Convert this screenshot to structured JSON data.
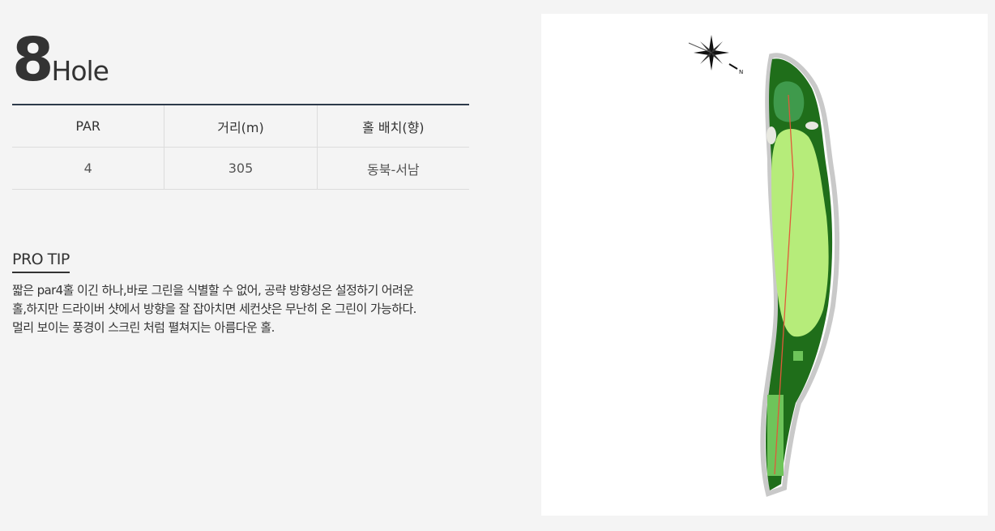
{
  "hole": {
    "number": "8",
    "label": "Hole"
  },
  "info_table": {
    "headers": [
      "PAR",
      "거리(m)",
      "홀 배치(향)"
    ],
    "values": [
      "4",
      "305",
      "동북-서남"
    ]
  },
  "pro_tip": {
    "title": "PRO TIP",
    "lines": [
      "짧은 par4홀 이긴 하나,바로 그린을 식별할 수 없어, 공략 방향성은 설정하기 어려운",
      "홀,하지만 드라이버 샷에서 방향을 잘 잡아치면 세컨샷은 무난히 온 그린이 가능하다.",
      "멀리 보이는 풍경이 스크린 처럼 펼쳐지는 아름다운 홀."
    ]
  },
  "map": {
    "compass_icon": "compass-rose-icon",
    "colors": {
      "rough": "#1f6e1a",
      "fairway": "#b6ec7a",
      "green": "#3f9a4c",
      "tee": "#6ec45a",
      "cart_path": "#c9c9c9",
      "route_line": "#e05a3a"
    }
  }
}
